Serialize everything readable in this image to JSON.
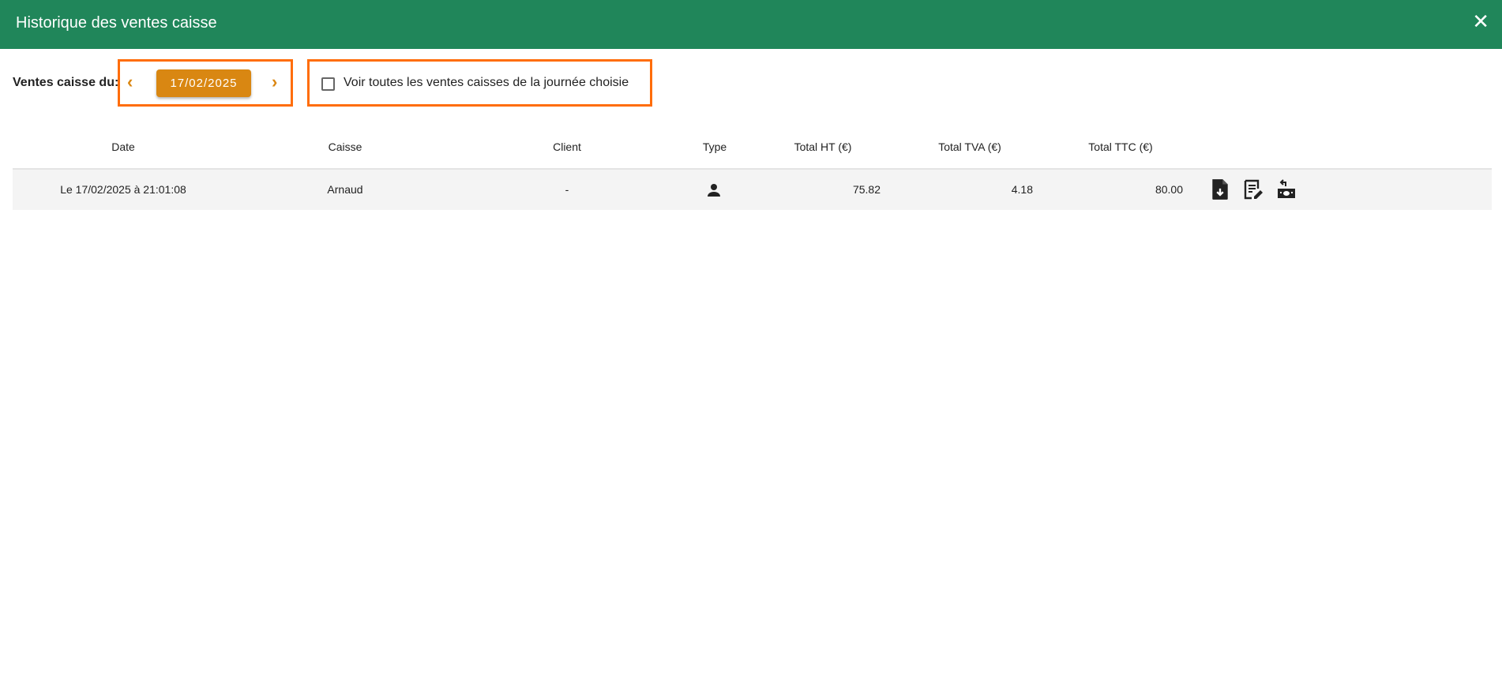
{
  "dialog": {
    "title": "Historique des ventes caisse",
    "close_label": "✕"
  },
  "filter": {
    "label": "Ventes caisse du:",
    "prev": "‹",
    "next": "›",
    "date": "17/02/2025",
    "checkbox_label": "Voir toutes les ventes caisses de la journée choisie",
    "checkbox_checked": false
  },
  "table": {
    "headers": [
      "Date",
      "Caisse",
      "Client",
      "Type",
      "Total HT (€)",
      "Total TVA (€)",
      "Total TTC (€)"
    ],
    "rows": [
      {
        "date": "Le 17/02/2025 à 21:01:08",
        "caisse": "Arnaud",
        "client": "-",
        "type": "person-icon",
        "ht": "75.82",
        "tva": "4.18",
        "ttc": "80.00",
        "actions": [
          "download-file-icon",
          "edit-receipt-icon",
          "refund-cash-icon"
        ]
      }
    ]
  },
  "colors": {
    "header": "#20865a",
    "accent": "#d98712",
    "highlight": "#ff6d0a"
  }
}
